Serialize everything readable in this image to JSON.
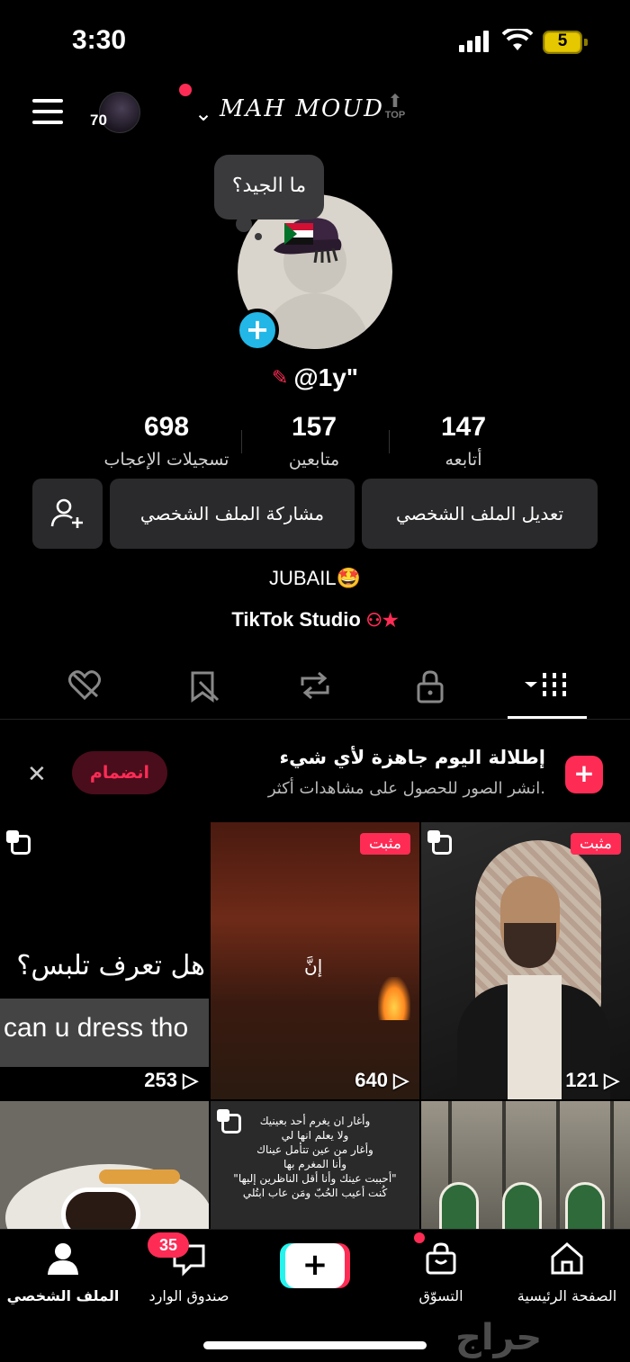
{
  "status_bar": {
    "time": "3:30",
    "battery": "5"
  },
  "header": {
    "avatar_count": "70",
    "username": "MAH MOUD",
    "top_label": "TOP"
  },
  "profile": {
    "bubble_text": "ما الجيد؟",
    "handle": "@1y\"",
    "stats": [
      {
        "value": "147",
        "label": "أتابعه"
      },
      {
        "value": "157",
        "label": "متابعين"
      },
      {
        "value": "698",
        "label": "تسجيلات الإعجاب"
      }
    ],
    "buttons": {
      "edit": "تعديل الملف الشخصي",
      "share": "مشاركة الملف الشخصي"
    },
    "bio": "JUBAIL🤩",
    "studio": "TikTok Studio"
  },
  "promo": {
    "title": "إطلالة اليوم جاهزة لأي شيء",
    "subtitle": "انشر الصور للحصول على مشاهدات أكثر.",
    "join": "انضمام"
  },
  "videos": [
    {
      "views": "253",
      "ar_text": "هل تعرف تلبس؟",
      "en_text": "can u dress tho"
    },
    {
      "views": "640",
      "pinned": "مثبت",
      "word": "إنَّ"
    },
    {
      "views": "121",
      "pinned": "مثبت"
    },
    {},
    {
      "poem": "وأغار ان يغرم أحد بعينيك\nولا يعلم انها لي\nوأغار من عين تتأمل عيناك\nوأنا المغرم بها\n\"أحببت عينك وأنا أقل الناظرين إليها\"\nكُنت أعيب الحُبّ ومَن عاب ابتُلي"
    },
    {}
  ],
  "bottom_nav": {
    "profile": "الملف الشخصي",
    "inbox": "صندوق الوارد",
    "inbox_badge": "35",
    "shop": "التسوّق",
    "home": "الصفحة الرئيسية"
  },
  "watermark": "حراج",
  "colors": {
    "accent": "#fe2c55",
    "cyan": "#25f4ee",
    "avatar_plus": "#22b7e6"
  }
}
